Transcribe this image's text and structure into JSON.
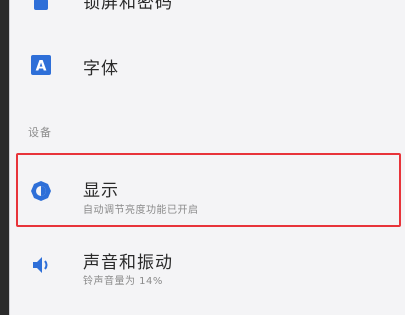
{
  "settings": {
    "top_partial": {
      "title": "锁屏和密码"
    },
    "font": {
      "title": "字体",
      "icon": "font-letter-a-icon",
      "icon_letter": "A"
    },
    "section_device": {
      "label": "设备"
    },
    "display": {
      "title": "显示",
      "subtitle": "自动调节亮度功能已开启",
      "icon": "brightness-icon"
    },
    "sound": {
      "title": "声音和振动",
      "subtitle": "铃声音量为 14%",
      "icon": "speaker-icon"
    }
  },
  "colors": {
    "accent": "#2e6fd8",
    "highlight_border": "#e8343a"
  }
}
